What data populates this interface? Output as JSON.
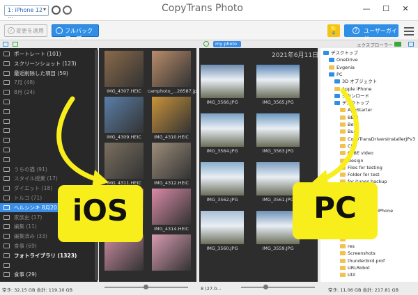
{
  "titlebar": {
    "device": "1: iPhone 12 ...",
    "app_name": "CopyTrans Photo",
    "window_controls": [
      "—",
      "☐",
      "✕"
    ]
  },
  "toolbar": {
    "apply_label": "変更を適用",
    "backup_label": "フルバックアップ",
    "guide_label": "ユーザーガイド"
  },
  "left_panel": {
    "categories": [
      {
        "label": "ポートレート (101)",
        "style": "normal"
      },
      {
        "label": "スクリーンショット (123)",
        "style": "normal"
      },
      {
        "label": "最近削除した項目 (59)",
        "style": "normal"
      },
      {
        "label": "7月 (48)",
        "style": "dim"
      },
      {
        "label": "8月 (24)",
        "style": "dim"
      },
      {
        "label": "",
        "style": "blank"
      },
      {
        "label": "",
        "style": "blank"
      },
      {
        "label": "",
        "style": "blank"
      },
      {
        "label": "",
        "style": "blank"
      },
      {
        "label": "",
        "style": "blank"
      },
      {
        "label": "",
        "style": "blank"
      },
      {
        "label": "",
        "style": "blank"
      },
      {
        "label": "うちの猫 (91)",
        "style": "dim"
      },
      {
        "label": "スタイル授業 (17)",
        "style": "dim"
      },
      {
        "label": "ダイエット (18)",
        "style": "dim"
      },
      {
        "label": "トルコ (71)",
        "style": "dim"
      },
      {
        "label": "ヘルシンキ 8月20",
        "style": "sel"
      },
      {
        "label": "家族史 (17)",
        "style": "dim"
      },
      {
        "label": "編集 (11)",
        "style": "dim"
      },
      {
        "label": "編集済み (33)",
        "style": "dim"
      },
      {
        "label": "食事 (69)",
        "style": "dim"
      },
      {
        "label": "フォトライブラリ (1323)",
        "style": "bold"
      },
      {
        "label": "",
        "style": "blank"
      },
      {
        "label": "食事 (29)",
        "style": "normal"
      }
    ]
  },
  "ios_grid": {
    "thumbs": [
      {
        "label": "IMG_4307.HEIC",
        "color": "#8a6a4a"
      },
      {
        "label": "camphoto_...28587.jpg",
        "color": "#b88c6a"
      },
      {
        "label": "IMG_4309.HEIC",
        "color": "#5a7fa8"
      },
      {
        "label": "IMG_4310.HEIC",
        "color": "#c9933a"
      },
      {
        "label": "IMG_4311.HEIC",
        "color": "#7b6f5f"
      },
      {
        "label": "IMG_4312.HEIC",
        "color": "#9c8d7a"
      },
      {
        "label": "IMG_4315.HEIC",
        "color": "#e2a4b8"
      },
      {
        "label": "IMG_4314.HEIC",
        "color": "#d98aa6"
      },
      {
        "label": "",
        "color": "#c98aa0"
      },
      {
        "label": "",
        "color": "#d79ab0"
      }
    ]
  },
  "pc_grid": {
    "tab_label": "my photo (8)",
    "date": "2021年6月11日",
    "thumbs": [
      {
        "label": "IMG_3566.JPG",
        "color": "#6f8db0"
      },
      {
        "label": "IMG_3565.JPG",
        "color": "#5d86b5"
      },
      {
        "label": "IMG_3564.JPG",
        "color": "#7aa0c4"
      },
      {
        "label": "IMG_3563.JPG",
        "color": "#6b98c0"
      },
      {
        "label": "IMG_3562.JPG",
        "color": "#8aaecd"
      },
      {
        "label": "IMG_3561.JPG",
        "color": "#7c9fc0"
      },
      {
        "label": "IMG_3560.JPG",
        "color": "#a9bfd4"
      },
      {
        "label": "IMG_3559.JPG",
        "color": "#6d91b8"
      }
    ]
  },
  "explorer": {
    "title": "エクスプローラー",
    "items": [
      {
        "label": "デスクトップ",
        "indent": 0,
        "blue": true
      },
      {
        "label": "OneDrive",
        "indent": 1,
        "blue": true
      },
      {
        "label": "Evgenia",
        "indent": 1,
        "blue": false
      },
      {
        "label": "PC",
        "indent": 1,
        "blue": true
      },
      {
        "label": "3D オブジェクト",
        "indent": 2,
        "blue": true
      },
      {
        "label": "Apple iPhone",
        "indent": 2,
        "blue": false
      },
      {
        "label": "ダウンロード",
        "indent": 2,
        "blue": true
      },
      {
        "label": "デスクトップ",
        "indent": 2,
        "blue": true
      },
      {
        "label": "AppStarter",
        "indent": 3,
        "blue": false
      },
      {
        "label": "BB-8",
        "indent": 3,
        "blue": false
      },
      {
        "label": "Beta",
        "indent": 3,
        "blue": false
      },
      {
        "label": "Bugs",
        "indent": 3,
        "blue": false
      },
      {
        "label": "CopyTransDriversInstallerJPv3",
        "indent": 3,
        "blue": false
      },
      {
        "label": "CSS",
        "indent": 3,
        "blue": false
      },
      {
        "label": "CTBE video",
        "indent": 3,
        "blue": false
      },
      {
        "label": "Design",
        "indent": 3,
        "blue": false
      },
      {
        "label": "Files for testing",
        "indent": 3,
        "blue": false
      },
      {
        "label": "Folder for test",
        "indent": 3,
        "blue": false
      },
      {
        "label": "for itunes backup",
        "indent": 3,
        "blue": false
      },
      {
        "label": "HEIC",
        "indent": 3,
        "blue": false
      },
      {
        "label": "...kup 2",
        "indent": 3,
        "blue": false
      },
      {
        "label": "",
        "indent": 3,
        "blue": false
      },
      {
        "label": "...子のiPhone iPhone",
        "indent": 3,
        "blue": false
      },
      {
        "label": "2",
        "indent": 3,
        "blue": false
      },
      {
        "label": "",
        "indent": 3,
        "blue": false
      },
      {
        "label": "...s.11-win32",
        "indent": 3,
        "blue": false
      },
      {
        "label": "",
        "indent": 3,
        "blue": false
      },
      {
        "label": "res",
        "indent": 3,
        "blue": false
      },
      {
        "label": "Screenshots",
        "indent": 3,
        "blue": false
      },
      {
        "label": "thunderbird.prof",
        "indent": 3,
        "blue": false
      },
      {
        "label": "URLRobot",
        "indent": 3,
        "blue": false
      },
      {
        "label": "Util",
        "indent": 3,
        "blue": false
      }
    ]
  },
  "status": {
    "left": "空き: 32.15 GB 合計: 119.10 GB",
    "mid": "8 (27.0...",
    "right": "空き: 11.06 GB 合計: 217.81 GB"
  },
  "overlays": {
    "ios": "iOS",
    "pc": "PC"
  },
  "colors": {
    "accent": "#2f8fe6",
    "overlay": "#f8ee1c",
    "arrow": "#f8ee1c"
  }
}
